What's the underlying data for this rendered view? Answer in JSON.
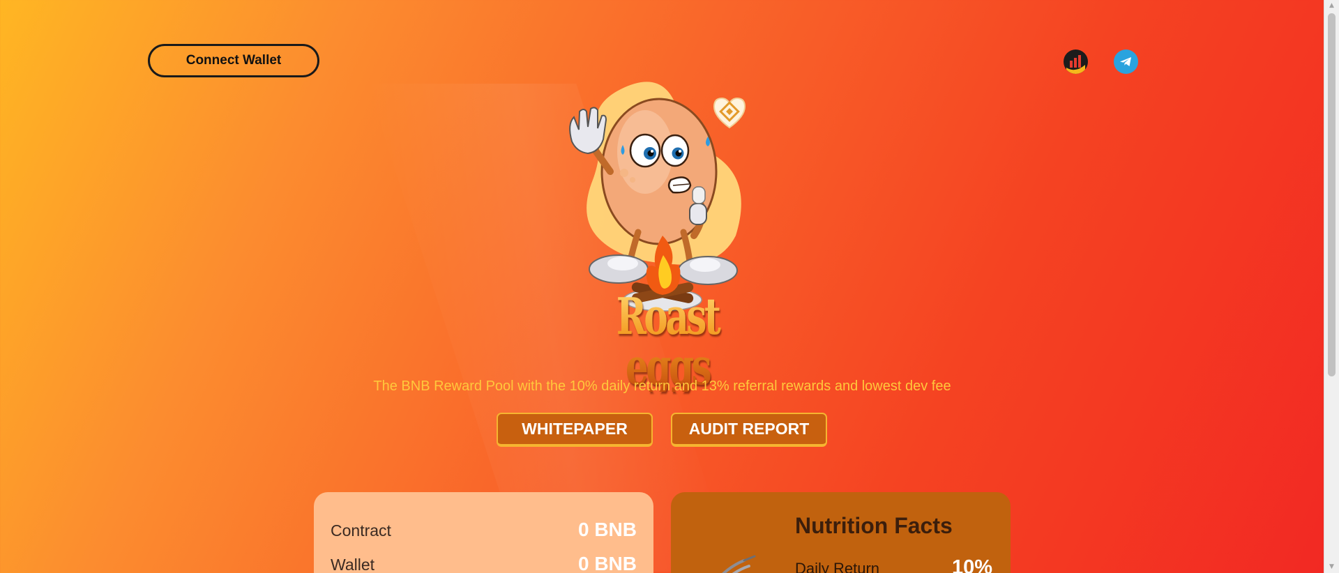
{
  "header": {
    "connect_label": "Connect Wallet",
    "social": [
      {
        "icon": "chart-icon",
        "color": "#1c1c1c"
      },
      {
        "icon": "telegram-icon",
        "color": "#2aa3de"
      }
    ]
  },
  "hero": {
    "logo_text": "Roast eggs",
    "mascot": "roast-egg-mascot",
    "badge": "bnb-heart-badge",
    "tagline": "The BNB Reward Pool with the 10% daily return and 13% referral rewards and lowest dev fee"
  },
  "actions": {
    "whitepaper_label": "WHITEPAPER",
    "audit_label": "AUDIT REPORT"
  },
  "balances": {
    "rows": [
      {
        "label": "Contract",
        "value": "0 BNB"
      },
      {
        "label": "Wallet",
        "value": "0 BNB"
      }
    ]
  },
  "nutrition": {
    "title": "Nutrition Facts",
    "rows": [
      {
        "label": "Daily Return",
        "value": "10%"
      }
    ]
  },
  "colors": {
    "accent_button": "#c8600f",
    "button_border": "#f6b530",
    "tagline": "#ffc83c",
    "card_light": "#ffbd8c",
    "card_dark": "#c1620e"
  }
}
